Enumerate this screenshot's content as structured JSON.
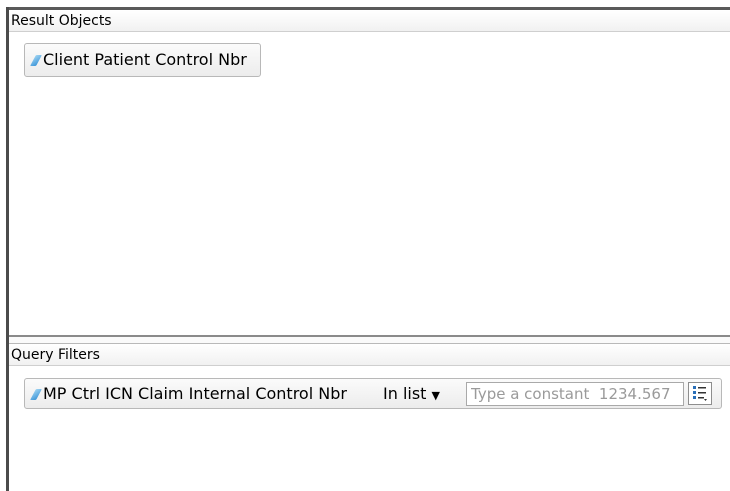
{
  "results_panel": {
    "title": "Result Objects",
    "objects": [
      {
        "label": "Client Patient Control Nbr",
        "icon": "dimension-icon"
      }
    ]
  },
  "filters_panel": {
    "title": "Query Filters",
    "filters": [
      {
        "object": "MP Ctrl ICN Claim Internal Control Nbr",
        "icon": "dimension-icon",
        "operator": "In list",
        "value_placeholder": "Type a constant  1234.567",
        "value_list_icon": "value-list-icon"
      }
    ]
  },
  "colors": {
    "frame": "#4b4b4b",
    "dimension_icon": "#3c95d8",
    "chip_border": "#b8b8b8"
  }
}
